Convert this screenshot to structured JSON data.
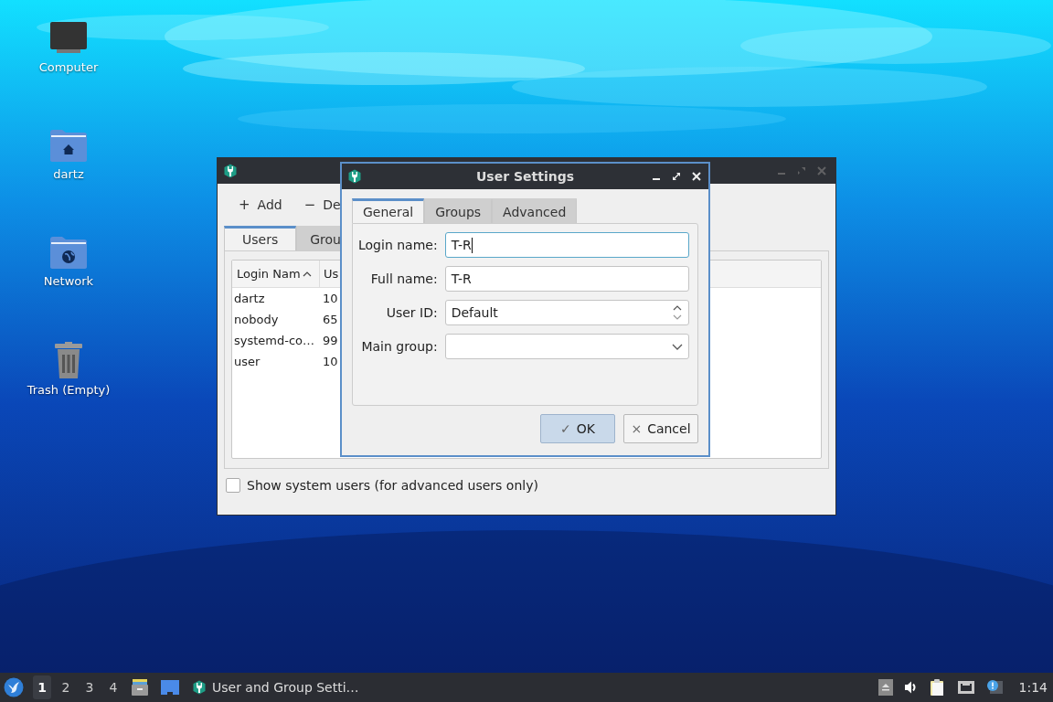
{
  "desktop_icons": [
    {
      "label": "Computer",
      "kind": "computer"
    },
    {
      "label": "dartz",
      "kind": "home"
    },
    {
      "label": "Network",
      "kind": "network"
    },
    {
      "label": "Trash (Empty)",
      "kind": "trash"
    }
  ],
  "main_window": {
    "toolbar": [
      {
        "icon": "+",
        "label": "Add"
      },
      {
        "icon": "−",
        "label": "De"
      }
    ],
    "tabs": [
      {
        "label": "Users",
        "selected": true
      },
      {
        "label": "Grou",
        "selected": false
      }
    ],
    "table": {
      "columns": [
        {
          "label": "Login Nam",
          "sorted_ascending": true
        },
        {
          "label": "Us"
        }
      ],
      "rows": [
        [
          "dartz",
          "10"
        ],
        [
          "nobody",
          "65"
        ],
        [
          "systemd-co…",
          "99"
        ],
        [
          "user",
          "10"
        ]
      ]
    },
    "show_system_users": {
      "label": "Show system users (for advanced users only)",
      "checked": false
    }
  },
  "dialog": {
    "title": "User Settings",
    "tabs": [
      {
        "label": "General",
        "selected": true
      },
      {
        "label": "Groups",
        "selected": false
      },
      {
        "label": "Advanced",
        "selected": false
      }
    ],
    "fields": [
      {
        "label": "Login name:",
        "value": "T-R",
        "kind": "text",
        "focused": true
      },
      {
        "label": "Full name:",
        "value": "T-R",
        "kind": "text",
        "focused": false
      },
      {
        "label": "User ID:",
        "value": "Default",
        "kind": "spin",
        "focused": false
      },
      {
        "label": "Main group:",
        "kind": "combo",
        "focused": false
      }
    ],
    "buttons": [
      {
        "icon": "✓",
        "label": "OK",
        "default": true
      },
      {
        "icon": "×",
        "label": "Cancel",
        "default": false
      }
    ]
  },
  "taskbar": {
    "workspaces": [
      {
        "label": "1",
        "selected": true
      },
      {
        "label": "2",
        "selected": false
      },
      {
        "label": "3",
        "selected": false
      },
      {
        "label": "4",
        "selected": false
      }
    ],
    "tasks": [
      {
        "label": "User and Group Setti…"
      }
    ],
    "clock": "1:14"
  }
}
